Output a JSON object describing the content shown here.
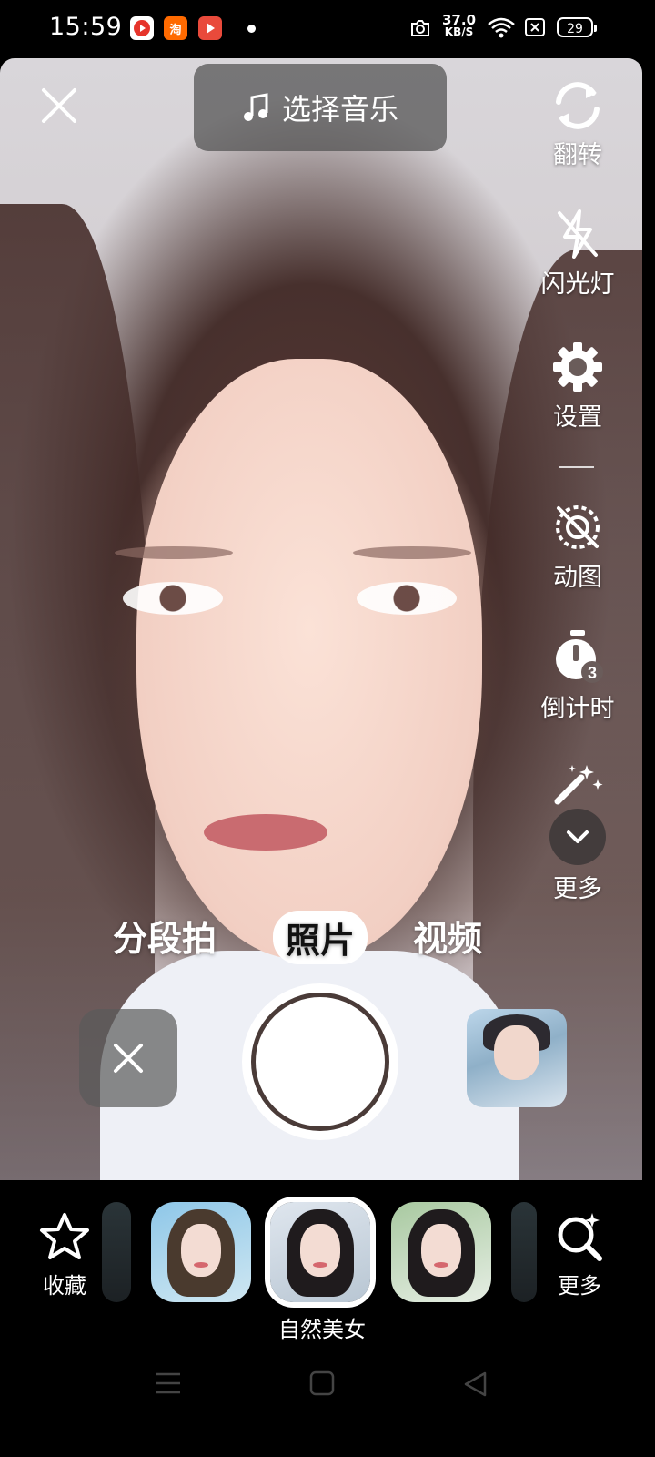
{
  "status_bar": {
    "time": "15:59",
    "apps": [
      {
        "name": "app-icon-red",
        "color": "#e6342b",
        "glyph": "●"
      },
      {
        "name": "taobao-icon",
        "color": "#ff6a00",
        "glyph": "淘"
      },
      {
        "name": "video-app-icon",
        "color": "#e94a3b",
        "glyph": "▶"
      }
    ],
    "net_speed_value": "37.0",
    "net_speed_unit": "KB/S",
    "battery": "29"
  },
  "top": {
    "music_label": "选择音乐"
  },
  "side_controls": [
    {
      "id": "flip",
      "label": "翻转"
    },
    {
      "id": "flash",
      "label": "闪光灯"
    },
    {
      "id": "settings",
      "label": "设置"
    },
    {
      "id": "animated",
      "label": "动图"
    },
    {
      "id": "timer",
      "label": "倒计时",
      "badge": "3"
    },
    {
      "id": "more",
      "label": "更多"
    }
  ],
  "modes": [
    {
      "label": "分段拍",
      "active": false
    },
    {
      "label": "照片",
      "active": true
    },
    {
      "label": "视频",
      "active": false
    }
  ],
  "bottom": {
    "favorite_label": "收藏",
    "selected_filter_name": "自然美女",
    "more_label": "更多"
  },
  "colors": {
    "accent": "#ffffff",
    "overlay": "#505050"
  }
}
